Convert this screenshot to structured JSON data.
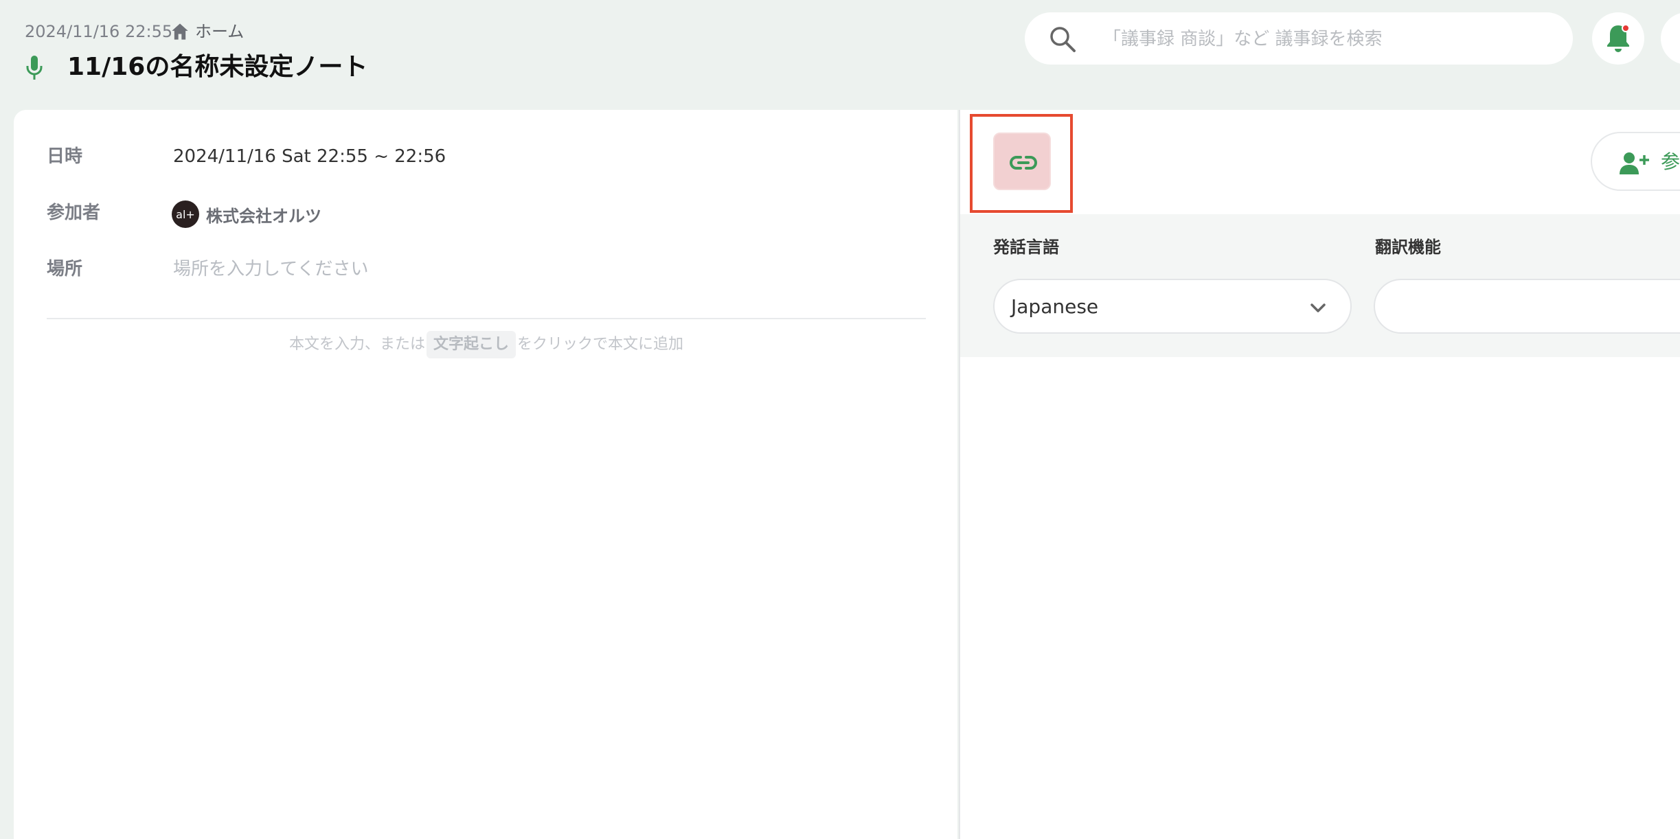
{
  "header": {
    "datetime": "2024/11/16 22:55",
    "breadcrumb_home": "ホーム",
    "title": "11/16の名称未設定ノート"
  },
  "search": {
    "placeholder": "「議事録 商談」など 議事録を検索"
  },
  "note": {
    "date_label": "日時",
    "date_value": "2024/11/16 Sat 22:55 ~ 22:56",
    "participants_label": "参加者",
    "participant_avatar_text": "al+",
    "participant_name": "株式会社オルツ",
    "place_label": "場所",
    "place_placeholder": "場所を入力してください",
    "body_hint_before": "本文を入力、または",
    "body_hint_chip": "文字起こし",
    "body_hint_after": "をクリックで本文に追加"
  },
  "right_panel": {
    "add_participant_label": "参",
    "speech_language_label": "発話言語",
    "speech_language_value": "Japanese",
    "translation_label": "翻訳機能"
  },
  "colors": {
    "accent_green": "#3c9a58",
    "background": "#edf2ef",
    "highlight_red": "#e64a30",
    "link_button_bg": "#f2d0d1",
    "notification_dot": "#e53935"
  }
}
